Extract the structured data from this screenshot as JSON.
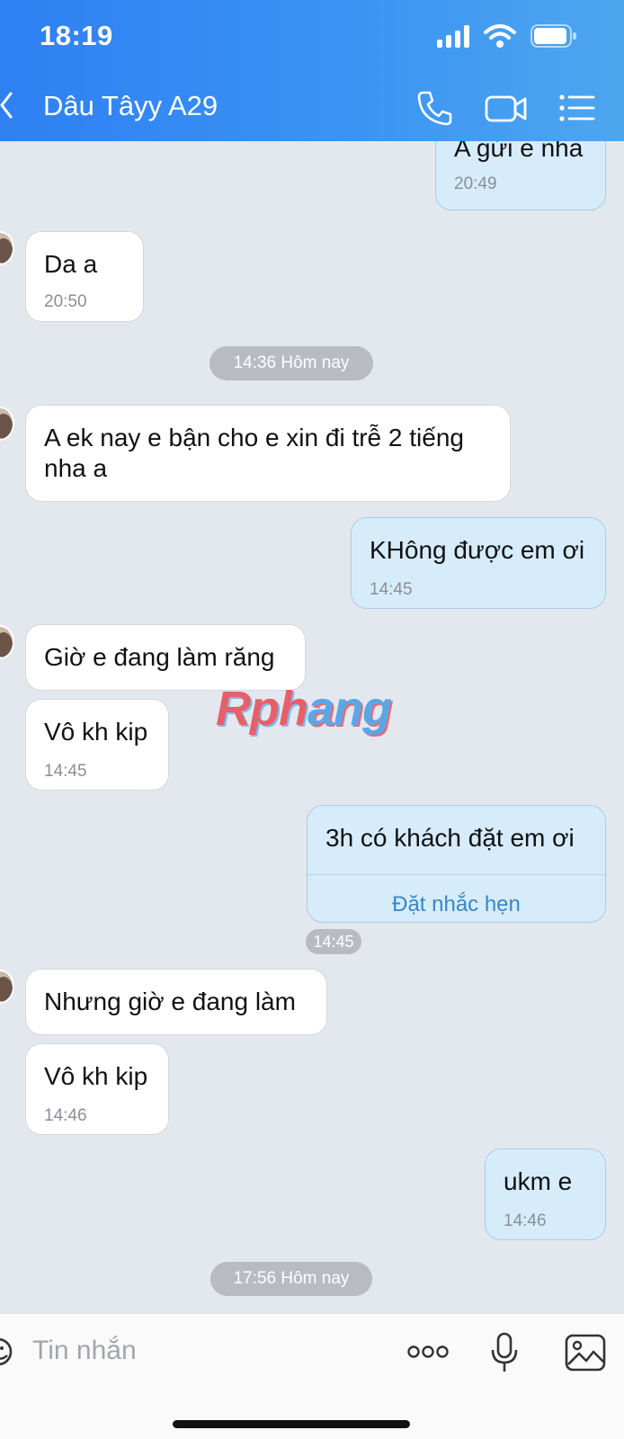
{
  "status_bar": {
    "time": "18:19"
  },
  "header": {
    "contact_name": "Dâu Tâyy A29"
  },
  "messages": [
    {
      "text": "A gửi e nha",
      "time": "20:49"
    },
    {
      "text": "Da a",
      "time": "20:50"
    },
    {
      "divider": "14:36 Hôm nay"
    },
    {
      "text": "A ek nay e bận cho e xin đi trễ 2 tiếng nha a"
    },
    {
      "text": "KHông được em ơi",
      "time": "14:45"
    },
    {
      "text": "Giờ e đang làm răng"
    },
    {
      "text": "Vô kh kip",
      "time": "14:45"
    },
    {
      "text": "3h có khách đặt em ơi",
      "action": "Đặt nhắc hẹn",
      "time": "14:45"
    },
    {
      "text": "Nhưng giờ e đang làm"
    },
    {
      "text": "Vô kh kip",
      "time": "14:46"
    },
    {
      "text": "ukm e",
      "time": "14:46"
    },
    {
      "divider": "17:56 Hôm nay"
    }
  ],
  "watermark": {
    "part1": "Rph",
    "part2": "ang"
  },
  "input": {
    "placeholder": "Tin nhắn"
  },
  "colors": {
    "header_start": "#2f80f3",
    "header_end": "#4ea6ef",
    "outgoing_bubble": "#d6ecfb",
    "incoming_bubble": "#ffffff",
    "chat_bg": "#e3e7ee"
  },
  "icons": [
    "back-icon",
    "phone-icon",
    "video-call-icon",
    "menu-list-icon",
    "sticker-icon",
    "more-icon",
    "microphone-icon",
    "image-icon"
  ]
}
